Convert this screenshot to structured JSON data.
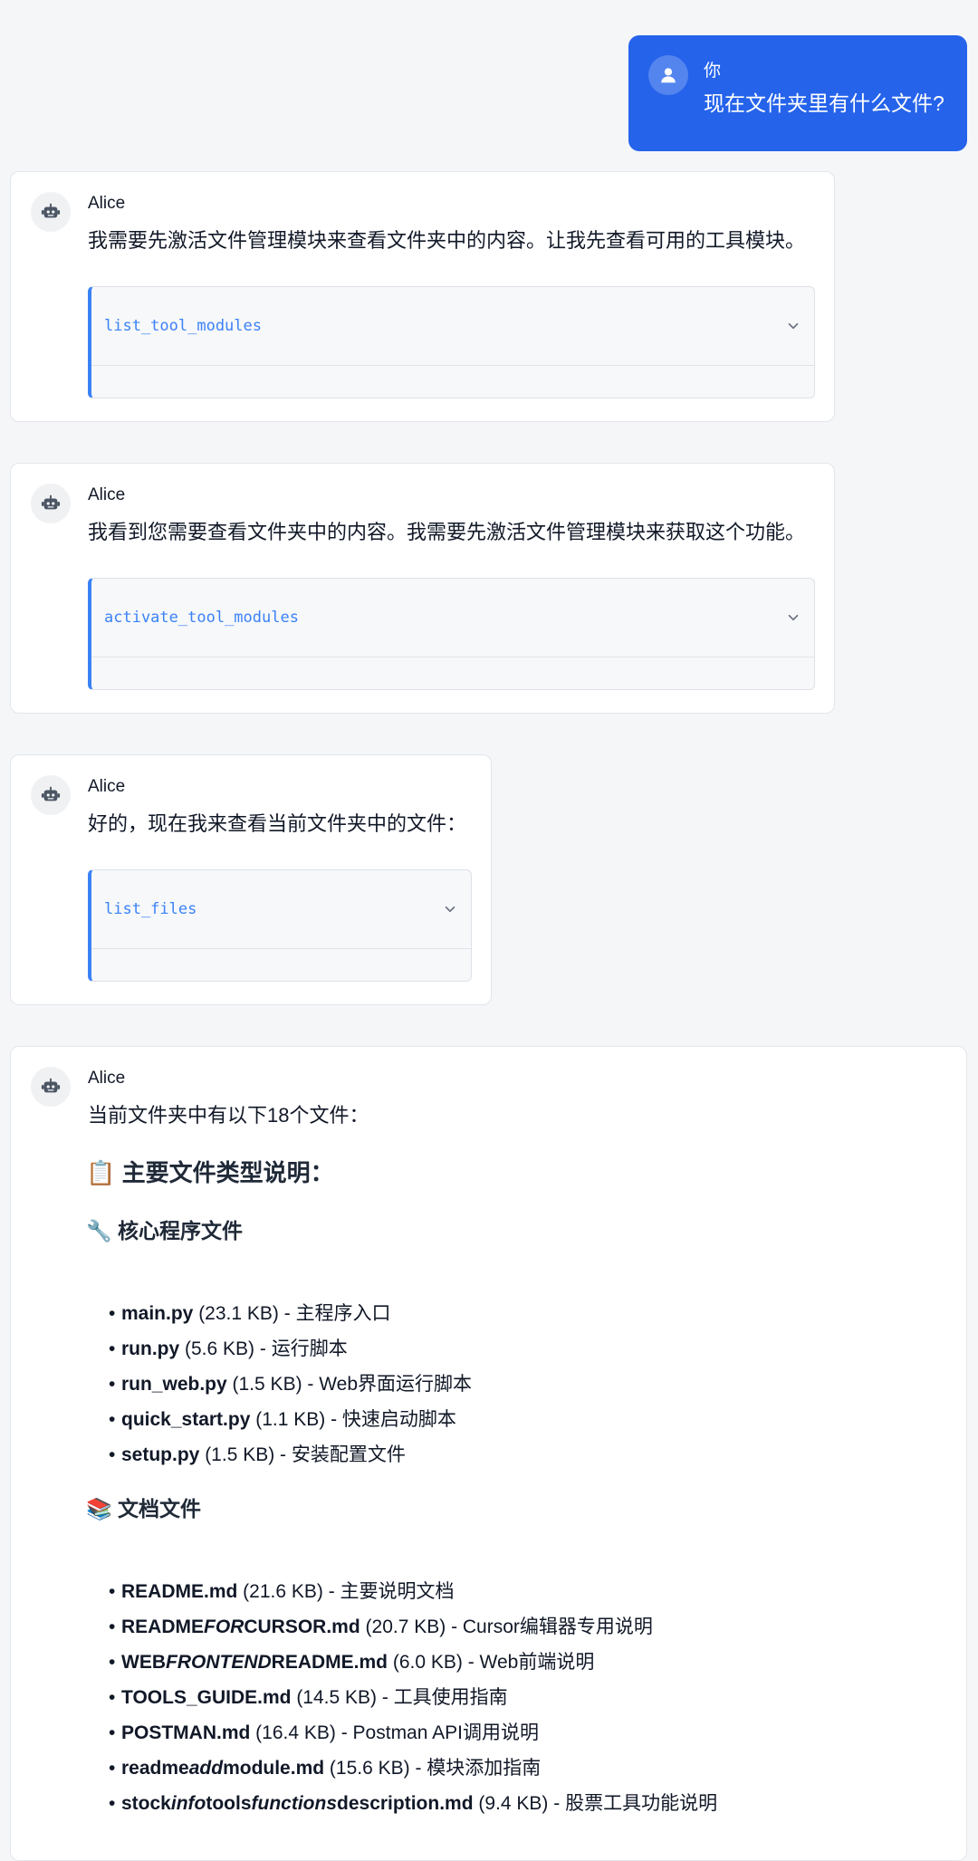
{
  "user_message": {
    "name": "你",
    "text": "现在文件夹里有什么文件?"
  },
  "messages": [
    {
      "name": "Alice",
      "text": "我需要先激活文件管理模块来查看文件夹中的内容。让我先查看可用的工具模块。",
      "tool": "list_tool_modules"
    },
    {
      "name": "Alice",
      "text": "我看到您需要查看文件夹中的内容。我需要先激活文件管理模块来获取这个功能。",
      "tool": "activate_tool_modules"
    },
    {
      "name": "Alice",
      "text": "好的，现在我来查看当前文件夹中的文件：",
      "tool": "list_files"
    }
  ],
  "final": {
    "name": "Alice",
    "text": "当前文件夹中有以下18个文件：",
    "heading": "主要文件类型说明：",
    "heading_icon": "📋",
    "sections": [
      {
        "icon": "🔧",
        "title": "核心程序文件",
        "items": [
          {
            "name": "main.py",
            "desc": " (23.1 KB) - 主程序入口"
          },
          {
            "name": "run.py",
            "desc": " (5.6 KB) - 运行脚本"
          },
          {
            "name": "run_web.py",
            "desc": " (1.5 KB) - Web界面运行脚本"
          },
          {
            "name": "quick_start.py",
            "desc": " (1.1 KB) - 快速启动脚本"
          },
          {
            "name": "setup.py",
            "desc": " (1.5 KB) - 安装配置文件"
          }
        ]
      },
      {
        "icon": "📚",
        "title": "文档文件",
        "items": [
          {
            "name_parts": [
              "README.md"
            ],
            "desc": " (21.6 KB) - 主要说明文档"
          },
          {
            "name_parts": [
              "README",
              "FOR",
              "CURSOR.md"
            ],
            "desc": " (20.7 KB) - Cursor编辑器专用说明"
          },
          {
            "name_parts": [
              "WEB",
              "FRONTEND",
              "README.md"
            ],
            "desc": " (6.0 KB) - Web前端说明"
          },
          {
            "name_parts": [
              "TOOLS_GUIDE.md"
            ],
            "desc": " (14.5 KB) - 工具使用指南"
          },
          {
            "name_parts": [
              "POSTMAN.md"
            ],
            "desc": " (16.4 KB) - Postman API调用说明"
          },
          {
            "name_parts": [
              "readme",
              "add",
              "module.md"
            ],
            "desc": " (15.6 KB) - 模块添加指南"
          },
          {
            "name_parts": [
              "stock",
              "info",
              "tools",
              "functions",
              "description.md"
            ],
            "desc": " (9.4 KB) - 股票工具功能说明"
          }
        ]
      }
    ]
  },
  "colors": {
    "accent": "#2563eb",
    "tool_accent": "#3b82f6",
    "background": "#f5f6f8"
  }
}
